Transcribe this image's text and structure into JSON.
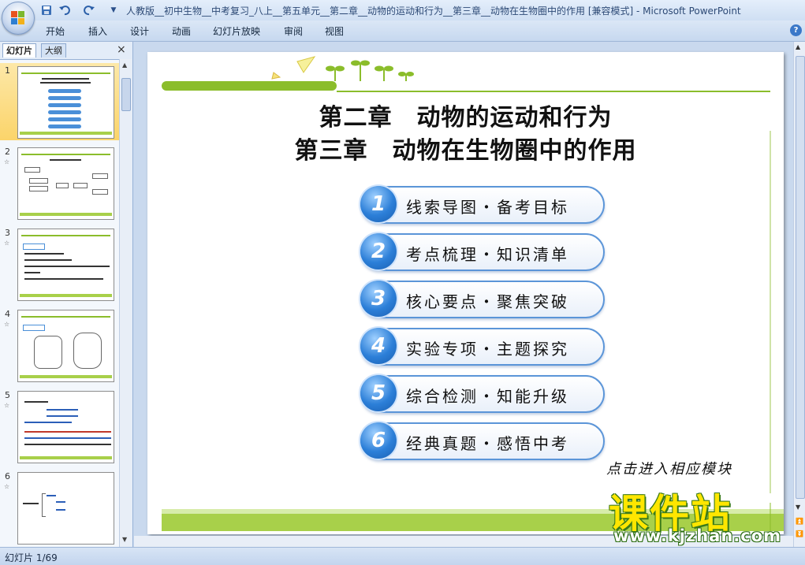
{
  "window": {
    "title": "人教版__初中生物__中考复习_八上__第五单元__第二章__动物的运动和行为__第三章__动物在生物圈中的作用 [兼容模式] - Microsoft PowerPoint"
  },
  "ribbon": {
    "tabs": [
      "开始",
      "插入",
      "设计",
      "动画",
      "幻灯片放映",
      "审阅",
      "视图"
    ]
  },
  "panel": {
    "tab_slides": "幻灯片",
    "tab_outline": "大纲",
    "close": "×",
    "slide_numbers": [
      "1",
      "2",
      "3",
      "4",
      "5",
      "6"
    ],
    "selected": 1
  },
  "slide": {
    "title_line1": "第二章　动物的运动和行为",
    "title_line2": "第三章　动物在生物圈中的作用",
    "menu": [
      {
        "num": "1",
        "label": "线索导图・备考目标"
      },
      {
        "num": "2",
        "label": "考点梳理・知识清单"
      },
      {
        "num": "3",
        "label": "核心要点・聚焦突破"
      },
      {
        "num": "4",
        "label": "实验专项・主题探究"
      },
      {
        "num": "5",
        "label": "综合检测・知能升级"
      },
      {
        "num": "6",
        "label": "经典真题・感悟中考"
      }
    ],
    "hint": "点击进入相应模块"
  },
  "status": {
    "slide_counter": "幻灯片 1/69"
  },
  "watermark": {
    "name": "课件站",
    "url": "www.kjzhan.com"
  },
  "colors": {
    "accent_green": "#8bbd2b",
    "button_blue": "#2c7fd8",
    "ribbon_bg": "#c6d8ef"
  }
}
